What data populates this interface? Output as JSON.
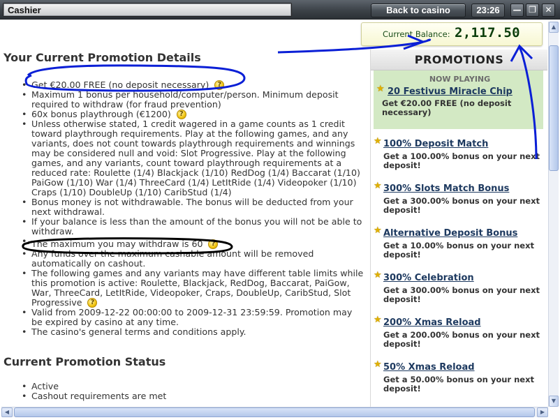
{
  "window": {
    "title": "Cashier",
    "back_button": "Back to casino",
    "clock": "23:26",
    "minimize": "—",
    "restore": "❐",
    "close": "✕"
  },
  "balance": {
    "label": "Current Balance:",
    "value": "2,117.50"
  },
  "details": {
    "heading": "Your Current Promotion Details",
    "items": [
      "Get €20.00 FREE (no deposit necessary)",
      "Maximum 1 bonus per household/computer/person. Minimum deposit required to withdraw (for fraud prevention)",
      "60x bonus playthrough (€1200)",
      "Unless otherwise stated, 1 credit wagered in a game counts as 1 credit toward playthrough requirements. Play at the following games, and any variants, does not count towards playthrough requirements and winnings may be considered null and void: Slot Progressive. Play at the following games, and any variants, count toward playthrough requirements at a reduced rate: Roulette (1/4) Blackjack (1/10) RedDog (1/4) Baccarat (1/10) PaiGow (1/10) War (1/4) ThreeCard (1/4) LetItRide (1/4) Videopoker (1/10) Craps (1/10) DoubleUp (1/10) CaribStud (1/4)",
      "Bonus money is not withdrawable. The bonus will be deducted from your next withdrawal.",
      "If your balance is less than the amount of the bonus you will not be able to withdraw.",
      "The maximum you may withdraw is 60",
      "Any funds over the maximum cashable amount will be removed automatically on cashout.",
      "The following games and any variants may have different table limits while this promotion is active: Roulette, Blackjack, RedDog, Baccarat, PaiGow, War, ThreeCard, LetItRide, Videopoker, Craps, DoubleUp, CaribStud, Slot Progressive",
      "Valid from 2009-12-22 00:00:00 to 2009-12-31 23:59:59. Promotion may be expired by casino at any time.",
      "The casino's general terms and conditions apply."
    ],
    "help_icon": "?"
  },
  "status": {
    "heading": "Current Promotion Status",
    "items": [
      "Active",
      "Cashout requirements are met"
    ]
  },
  "promotions": {
    "header": "PROMOTIONS",
    "now_playing_label": "NOW PLAYING",
    "current": {
      "title": "20 Festivus Miracle Chip",
      "desc": "Get €20.00 FREE (no deposit necessary)"
    },
    "list": [
      {
        "title": "100% Deposit Match",
        "desc": "Get a 100.00% bonus on your next deposit!"
      },
      {
        "title": "300% Slots Match Bonus",
        "desc": "Get a 300.00% bonus on your next deposit!"
      },
      {
        "title": "Alternative Deposit Bonus",
        "desc": "Get a 10.00% bonus on your next deposit!"
      },
      {
        "title": "300% Celebration",
        "desc": "Get a 300.00% bonus on your next deposit!"
      },
      {
        "title": "200% Xmas Reload",
        "desc": "Get a 200.00% bonus on your next deposit!"
      },
      {
        "title": "50% Xmas Reload",
        "desc": "Get a 50.00% bonus on your next deposit!"
      }
    ]
  },
  "colors": {
    "title_bar": "#3c4248",
    "now_playing_bg": "#d3e9c4",
    "link": "#1e3a60",
    "balance_value": "#0b3d0b",
    "annotation_blue": "#0a1fd6",
    "annotation_black": "#000000"
  }
}
